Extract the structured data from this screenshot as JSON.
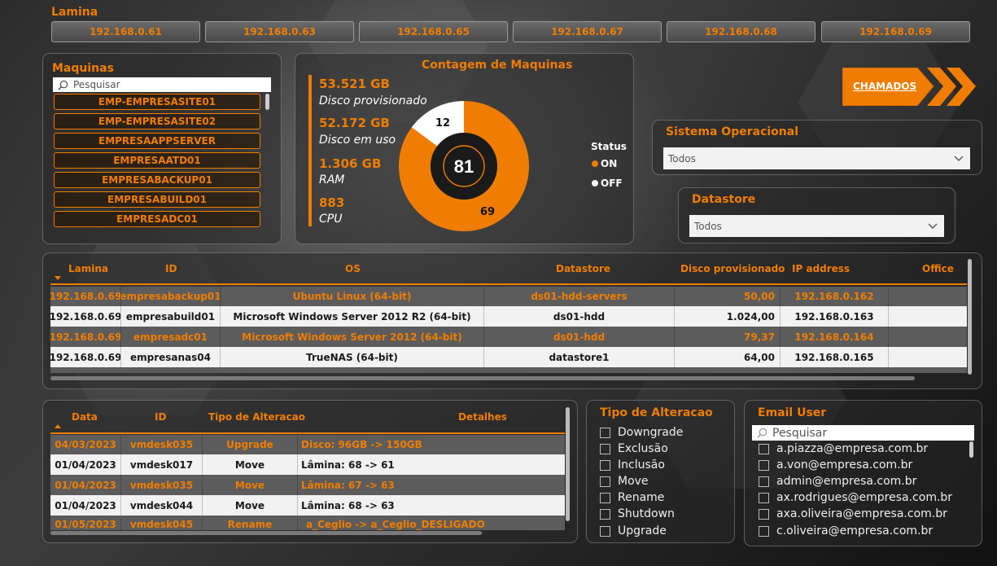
{
  "lamina": {
    "title": "Lamina",
    "ips": [
      "192.168.0.61",
      "192.168.0.63",
      "192.168.0.65",
      "192.168.0.67",
      "192.168.0.68",
      "192.168.0.69"
    ]
  },
  "maquinas": {
    "title": "Maquinas",
    "search_placeholder": "Pesquisar",
    "items": [
      "EMP-EMPRESASITE01",
      "EMP-EMPRESASITE02",
      "EMPRESAAPPSERVER",
      "EMPRESAATD01",
      "EMPRESABACKUP01",
      "EMPRESABUILD01",
      "EMPRESADC01"
    ]
  },
  "contagem": {
    "title": "Contagem de Maquinas",
    "stats": [
      {
        "value": "53.521 GB",
        "label": "Disco provisionado"
      },
      {
        "value": "52.172 GB",
        "label": "Disco em uso"
      },
      {
        "value": "1.306 GB",
        "label": "RAM"
      },
      {
        "value": "883",
        "label": "CPU"
      }
    ],
    "total": "81",
    "on_count": "69",
    "off_count": "12",
    "status_title": "Status",
    "status_on": "ON",
    "status_off": "OFF",
    "colors": {
      "on": "#f07d00",
      "off": "#ffffff"
    }
  },
  "chamados": {
    "label": "CHAMADOS"
  },
  "sistema_operacional": {
    "title": "Sistema Operacional",
    "value": "Todos"
  },
  "datastore": {
    "title": "Datastore",
    "value": "Todos"
  },
  "machines_table": {
    "headers": [
      "Lamina",
      "ID",
      "OS",
      "Datastore",
      "Disco provisionado",
      "IP address",
      "Office"
    ],
    "rows": [
      [
        "192.168.0.69",
        "empresabackup01",
        "Ubuntu Linux (64-bit)",
        "ds01-hdd-servers",
        "50,00",
        "192.168.0.162",
        ""
      ],
      [
        "192.168.0.69",
        "empresabuild01",
        "Microsoft Windows Server 2012 R2 (64-bit)",
        "ds01-hdd",
        "1.024,00",
        "192.168.0.163",
        ""
      ],
      [
        "192.168.0.69",
        "empresadc01",
        "Microsoft Windows Server 2012 (64-bit)",
        "ds01-hdd",
        "79,37",
        "192.168.0.164",
        ""
      ],
      [
        "192.168.0.69",
        "empresanas04",
        "TrueNAS (64-bit)",
        "datastore1",
        "64,00",
        "192.168.0.165",
        ""
      ]
    ]
  },
  "changes_table": {
    "headers": [
      "Data",
      "ID",
      "Tipo de Alteracao",
      "Detalhes"
    ],
    "rows": [
      [
        "04/03/2023",
        "vmdesk035",
        "Upgrade",
        "Disco: 96GB -> 150GB"
      ],
      [
        "01/04/2023",
        "vmdesk017",
        "Move",
        "Lâmina: 68 -> 61"
      ],
      [
        "01/04/2023",
        "vmdesk035",
        "Move",
        "Lâmina: 67 -> 63"
      ],
      [
        "01/04/2023",
        "vmdesk044",
        "Move",
        "Lâmina: 68 -> 63"
      ],
      [
        "01/05/2023",
        "vmdesk045",
        "Rename",
        "a_Ceglio -> a_Ceglio_DESLIGADO"
      ]
    ]
  },
  "tipo_alteracao": {
    "title": "Tipo de Alteracao",
    "options": [
      "Downgrade",
      "Exclusão",
      "Inclusão",
      "Move",
      "Rename",
      "Shutdown",
      "Upgrade"
    ]
  },
  "email_user": {
    "title": "Email User",
    "search_placeholder": "Pesquisar",
    "options": [
      "a.piazza@empresa.com.br",
      "a.von@empresa.com.br",
      "admin@empresa.com.br",
      "ax.rodrigues@empresa.com.br",
      "axa.oliveira@empresa.com.br",
      "c.oliveira@empresa.com.br"
    ]
  }
}
